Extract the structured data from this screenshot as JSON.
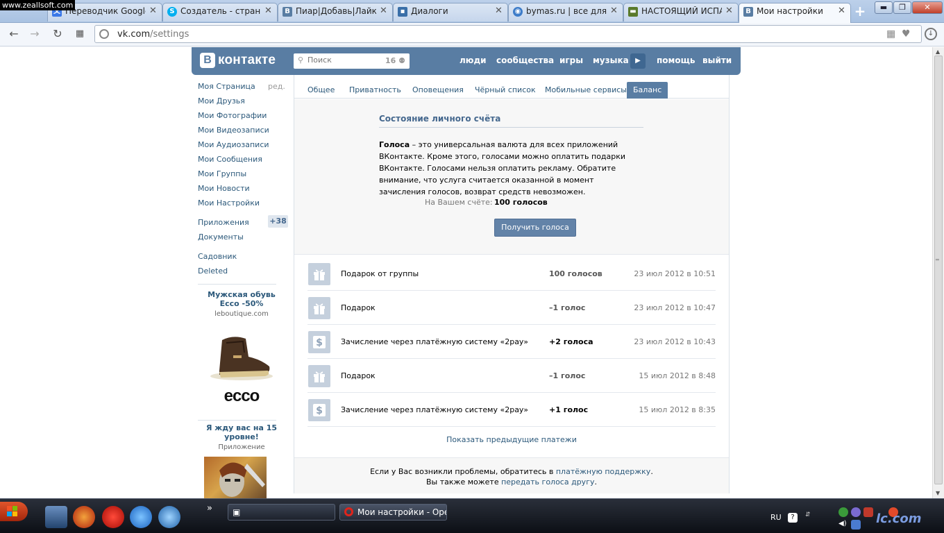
{
  "watermark": "www.zeallsoft.com",
  "browser": {
    "tabs": [
      {
        "title": "Переводчик Google",
        "favicon": "google-translate-icon",
        "color": "#3b78e7"
      },
      {
        "title": "Создатель - страни",
        "favicon": "skype-icon",
        "color": "#00aff0"
      },
      {
        "title": "Пиар|Добавь|Лайки",
        "favicon": "vk-icon",
        "color": "#597da3"
      },
      {
        "title": "Диалоги",
        "favicon": "dialog-icon",
        "color": "#3a6fa8"
      },
      {
        "title": "bymas.ru | все для",
        "favicon": "bymas-icon",
        "color": "#3d7cc9"
      },
      {
        "title": "НАСТОЯЩИЙ ИСПА",
        "favicon": "tank-icon",
        "color": "#5a7a2b"
      },
      {
        "title": "Мои настройки",
        "favicon": "vk-icon",
        "color": "#597da3"
      }
    ],
    "tab_close": "✕",
    "new_tab": "+",
    "window_buttons": {
      "minimize": "▬",
      "maximize": "❐",
      "close": "✕"
    },
    "address": {
      "host": "vk.com",
      "path": "/settings"
    }
  },
  "vk": {
    "logo_letter": "В",
    "logo_word": "контакте",
    "search": {
      "placeholder": "Поиск",
      "count": "16"
    },
    "nav": {
      "people": "люди",
      "communities": "сообщества",
      "games": "игры",
      "music": "музыка",
      "help": "помощь",
      "logout": "выйти"
    }
  },
  "leftmenu": {
    "edit": "ред.",
    "items": [
      "Моя Страница",
      "Мои Друзья",
      "Мои Фотографии",
      "Мои Видеозаписи",
      "Мои Аудиозаписи",
      "Мои Сообщения",
      "Мои Группы",
      "Мои Новости",
      "Мои Настройки"
    ],
    "apps": {
      "label": "Приложения",
      "badge": "+38"
    },
    "docs": "Документы",
    "extra": [
      "Садовник",
      "Deleted"
    ],
    "ad1": {
      "title": "Мужская обувь Ecco -50%",
      "domain": "leboutique.com",
      "brand": "ecco"
    },
    "ad2": {
      "title": "Я жду вас на 15 уровне!",
      "sub": "Приложение"
    }
  },
  "settings_tabs": [
    "Общее",
    "Приватность",
    "Оповещения",
    "Чёрный список",
    "Мобильные сервисы",
    "Баланс"
  ],
  "balance": {
    "title": "Состояние личного счёта",
    "term": "Голоса",
    "description": " – это универсальная валюта для всех приложений ВКонтакте. Кроме этого, голосами можно оплатить подарки ВКонтакте. Голосами нельзя оплатить рекламу. Обратите внимание, что услуга считается оказанной в момент зачисления голосов, возврат средств невозможен.",
    "label": "На Вашем счёте:",
    "value": "100 голосов",
    "button": "Получить голоса"
  },
  "transactions": [
    {
      "icon": "gift-icon",
      "name": "Подарок от группы",
      "amount": "100 голосов",
      "date": "23 июл 2012 в 10:51"
    },
    {
      "icon": "gift-icon",
      "name": "Подарок",
      "amount": "–1 голос",
      "date": "23 июл 2012 в 10:47"
    },
    {
      "icon": "dollar-icon",
      "name": "Зачисление через платёжную систему «2pay»",
      "amount": "+2 голоса",
      "date": "23 июл 2012 в 10:43"
    },
    {
      "icon": "gift-icon",
      "name": "Подарок",
      "amount": "–1 голос",
      "date": "15 июл 2012 в 8:48"
    },
    {
      "icon": "dollar-icon",
      "name": "Зачисление через платёжную систему «2pay»",
      "amount": "+1 голос",
      "date": "15 июл 2012 в 8:35"
    }
  ],
  "show_more": "Показать предыдущие платежи",
  "footer": {
    "line1_pre": "Если у Вас возникли проблемы, обратитесь в ",
    "line1_link": "платёжную поддержку",
    "line1_post": ".",
    "line2_pre": "Вы также можете ",
    "line2_link": "передать голоса другу",
    "line2_post": "."
  },
  "taskbar": {
    "task_active": "Мои настройки - Opera",
    "lang": "RU",
    "overflow": "»",
    "watermark": "lc.com"
  }
}
